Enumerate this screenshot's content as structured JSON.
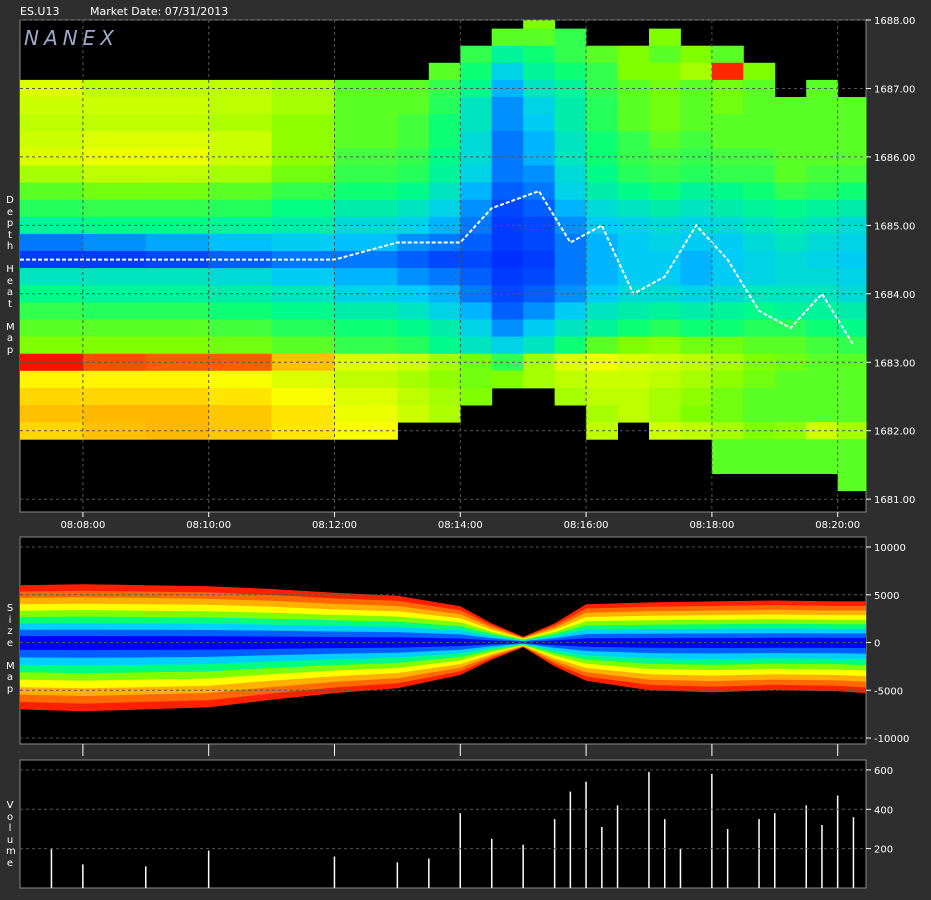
{
  "header": {
    "symbol": "ES.U13",
    "market_date": "Market Date: 07/31/2013"
  },
  "logo": "NANEX",
  "panel_labels": {
    "depth": "Depth Heat Map",
    "size": "Size Map",
    "volume": "Volume"
  },
  "colors": {
    "background": "#2e2e2e",
    "plot_bg": "#000000",
    "grid": "#555555",
    "text": "#ffffff",
    "logo": "#9fa9c9"
  },
  "chart_data": [
    {
      "type": "heatmap",
      "panel": "depth",
      "title": "Depth Heat Map",
      "x_ticks": [
        "08:08:00",
        "08:10:00",
        "08:12:00",
        "08:14:00",
        "08:16:00",
        "08:18:00",
        "08:20:00"
      ],
      "x_range": [
        "08:07:00",
        "08:20:27"
      ],
      "y_ticks": [
        "1688.00",
        "1687.00",
        "1686.00",
        "1685.00",
        "1684.00",
        "1683.00",
        "1682.00",
        "1681.00"
      ],
      "ylim": [
        1680.9,
        1688.0
      ],
      "grid": true,
      "colormap": [
        "#0000ff",
        "#00c8ff",
        "#00ff80",
        "#80ff00",
        "#ffff00",
        "#ff8000",
        "#ff0000"
      ],
      "columns_time": [
        "08:07:00",
        "08:08:00",
        "08:09:00",
        "08:10:00",
        "08:11:00",
        "08:12:00",
        "08:13:00",
        "08:13:30",
        "08:14:00",
        "08:14:30",
        "08:15:00",
        "08:15:30",
        "08:16:00",
        "08:16:30",
        "08:17:00",
        "08:17:30",
        "08:18:00",
        "08:18:30",
        "08:19:00",
        "08:19:30",
        "08:20:00"
      ],
      "price_levels": [
        1688.0,
        1687.75,
        1687.5,
        1687.25,
        1687.0,
        1686.75,
        1686.5,
        1686.25,
        1686.0,
        1685.75,
        1685.5,
        1685.25,
        1685.0,
        1684.75,
        1684.5,
        1684.25,
        1684.0,
        1683.75,
        1683.5,
        1683.25,
        1683.0,
        1682.75,
        1682.5,
        1682.25,
        1682.0,
        1681.75,
        1681.5,
        1681.25
      ],
      "intensity": [
        [
          null,
          null,
          null,
          null,
          null,
          null,
          null,
          null,
          null,
          null,
          0.5,
          null,
          null,
          null,
          null,
          null,
          null,
          null,
          null,
          null,
          null
        ],
        [
          null,
          null,
          null,
          null,
          null,
          null,
          null,
          null,
          null,
          0.45,
          0.45,
          0.4,
          null,
          null,
          0.5,
          null,
          null,
          null,
          null,
          null,
          null
        ],
        [
          null,
          null,
          null,
          null,
          null,
          null,
          null,
          null,
          0.4,
          0.3,
          0.35,
          0.4,
          0.45,
          0.5,
          0.45,
          0.5,
          0.45,
          null,
          null,
          null,
          null
        ],
        [
          null,
          null,
          null,
          null,
          null,
          null,
          null,
          0.45,
          0.35,
          0.2,
          0.3,
          0.35,
          0.4,
          0.5,
          0.5,
          0.55,
          0.95,
          0.5,
          null,
          null,
          null
        ],
        [
          0.62,
          0.58,
          0.58,
          0.58,
          0.55,
          0.45,
          0.45,
          0.4,
          0.32,
          0.15,
          0.25,
          0.3,
          0.4,
          0.45,
          0.48,
          0.45,
          0.48,
          0.45,
          null,
          0.45,
          null
        ],
        [
          0.6,
          0.6,
          0.6,
          0.58,
          0.55,
          0.45,
          0.45,
          0.38,
          0.25,
          0.12,
          0.2,
          0.28,
          0.38,
          0.45,
          0.48,
          0.45,
          0.48,
          0.45,
          0.45,
          0.45,
          0.45
        ],
        [
          0.58,
          0.58,
          0.58,
          0.56,
          0.52,
          0.45,
          0.42,
          0.35,
          0.25,
          0.12,
          0.18,
          0.28,
          0.38,
          0.45,
          0.48,
          0.45,
          0.45,
          0.45,
          0.45,
          0.45,
          0.45
        ],
        [
          0.6,
          0.62,
          0.62,
          0.6,
          0.52,
          0.45,
          0.42,
          0.35,
          0.22,
          0.1,
          0.15,
          0.25,
          0.35,
          0.4,
          0.45,
          0.42,
          0.45,
          0.45,
          0.45,
          0.45,
          0.45
        ],
        [
          0.62,
          0.64,
          0.64,
          0.6,
          0.52,
          0.42,
          0.4,
          0.32,
          0.22,
          0.1,
          0.15,
          0.25,
          0.35,
          0.4,
          0.42,
          0.4,
          0.42,
          0.42,
          0.45,
          0.45,
          0.45
        ],
        [
          0.55,
          0.58,
          0.58,
          0.55,
          0.48,
          0.4,
          0.38,
          0.3,
          0.2,
          0.1,
          0.12,
          0.22,
          0.32,
          0.38,
          0.4,
          0.38,
          0.4,
          0.4,
          0.45,
          0.42,
          0.42
        ],
        [
          0.45,
          0.48,
          0.48,
          0.45,
          0.4,
          0.35,
          0.32,
          0.25,
          0.15,
          0.08,
          0.1,
          0.2,
          0.28,
          0.32,
          0.35,
          0.3,
          0.32,
          0.35,
          0.4,
          0.38,
          0.35
        ],
        [
          0.38,
          0.4,
          0.4,
          0.38,
          0.33,
          0.28,
          0.25,
          0.2,
          0.12,
          0.06,
          0.08,
          0.15,
          0.22,
          0.25,
          0.28,
          0.25,
          0.28,
          0.3,
          0.32,
          0.3,
          0.28
        ],
        [
          0.3,
          0.32,
          0.32,
          0.3,
          0.28,
          0.22,
          0.2,
          0.15,
          0.1,
          0.05,
          0.06,
          0.12,
          0.18,
          0.2,
          0.22,
          0.2,
          0.22,
          0.25,
          0.28,
          0.25,
          0.22
        ],
        [
          0.1,
          0.12,
          0.14,
          0.16,
          0.18,
          0.16,
          0.12,
          0.1,
          0.08,
          0.05,
          0.06,
          0.1,
          0.15,
          0.18,
          0.2,
          0.18,
          0.18,
          0.22,
          0.25,
          0.22,
          0.2
        ],
        [
          0.05,
          0.05,
          0.06,
          0.08,
          0.1,
          0.1,
          0.08,
          0.06,
          0.06,
          0.04,
          0.05,
          0.1,
          0.15,
          0.18,
          0.18,
          0.15,
          0.18,
          0.2,
          0.22,
          0.2,
          0.18
        ],
        [
          0.25,
          0.25,
          0.25,
          0.22,
          0.18,
          0.15,
          0.12,
          0.1,
          0.08,
          0.05,
          0.06,
          0.1,
          0.15,
          0.18,
          0.18,
          0.15,
          0.18,
          0.2,
          0.22,
          0.22,
          0.2
        ],
        [
          0.32,
          0.3,
          0.3,
          0.28,
          0.25,
          0.2,
          0.18,
          0.15,
          0.1,
          0.06,
          0.08,
          0.12,
          0.18,
          0.22,
          0.22,
          0.2,
          0.22,
          0.25,
          0.25,
          0.25,
          0.22
        ],
        [
          0.4,
          0.38,
          0.38,
          0.35,
          0.32,
          0.28,
          0.25,
          0.2,
          0.15,
          0.08,
          0.12,
          0.18,
          0.25,
          0.28,
          0.3,
          0.28,
          0.3,
          0.32,
          0.3,
          0.3,
          0.28
        ],
        [
          0.45,
          0.45,
          0.45,
          0.42,
          0.38,
          0.35,
          0.32,
          0.28,
          0.2,
          0.12,
          0.18,
          0.25,
          0.3,
          0.35,
          0.38,
          0.35,
          0.35,
          0.38,
          0.38,
          0.35,
          0.32
        ],
        [
          0.5,
          0.5,
          0.5,
          0.48,
          0.45,
          0.4,
          0.38,
          0.32,
          0.25,
          0.2,
          0.25,
          0.35,
          0.45,
          0.5,
          0.52,
          0.48,
          0.48,
          0.45,
          0.45,
          0.42,
          0.4
        ],
        [
          0.98,
          0.9,
          0.88,
          0.88,
          0.75,
          0.62,
          0.6,
          0.55,
          0.48,
          0.4,
          0.55,
          0.62,
          0.65,
          0.62,
          0.6,
          0.58,
          0.55,
          0.5,
          0.48,
          0.45,
          0.45
        ],
        [
          0.68,
          0.68,
          0.68,
          0.66,
          0.62,
          0.58,
          0.55,
          0.52,
          0.48,
          0.5,
          0.55,
          0.58,
          0.6,
          0.6,
          0.58,
          0.55,
          0.52,
          0.48,
          0.45,
          0.45,
          0.45
        ],
        [
          0.72,
          0.72,
          0.72,
          0.7,
          0.66,
          0.62,
          0.58,
          0.55,
          0.5,
          null,
          null,
          0.55,
          0.58,
          0.58,
          0.55,
          0.52,
          0.48,
          0.45,
          0.45,
          0.45,
          0.45
        ],
        [
          0.75,
          0.76,
          0.76,
          0.74,
          0.7,
          0.64,
          0.6,
          0.56,
          null,
          null,
          null,
          null,
          0.55,
          0.58,
          0.55,
          0.5,
          0.48,
          0.45,
          0.45,
          0.45,
          0.45
        ],
        [
          0.72,
          0.75,
          0.76,
          0.74,
          0.7,
          0.66,
          null,
          null,
          null,
          null,
          null,
          null,
          0.58,
          null,
          0.6,
          0.58,
          0.55,
          0.5,
          0.52,
          0.6,
          0.55
        ],
        [
          null,
          null,
          null,
          null,
          null,
          null,
          null,
          null,
          null,
          null,
          null,
          null,
          null,
          null,
          null,
          null,
          0.45,
          0.45,
          0.45,
          0.45,
          0.45
        ],
        [
          null,
          null,
          null,
          null,
          null,
          null,
          null,
          null,
          null,
          null,
          null,
          null,
          null,
          null,
          null,
          null,
          0.45,
          0.45,
          0.45,
          0.45,
          0.45
        ],
        [
          null,
          null,
          null,
          null,
          null,
          null,
          null,
          null,
          null,
          null,
          null,
          null,
          null,
          null,
          null,
          null,
          null,
          null,
          null,
          null,
          0.45
        ]
      ],
      "trade_price_path": [
        {
          "t": "08:07:00",
          "p": 1684.5
        },
        {
          "t": "08:08:00",
          "p": 1684.5
        },
        {
          "t": "08:09:00",
          "p": 1684.5
        },
        {
          "t": "08:10:00",
          "p": 1684.5
        },
        {
          "t": "08:11:00",
          "p": 1684.5
        },
        {
          "t": "08:12:00",
          "p": 1684.5
        },
        {
          "t": "08:13:00",
          "p": 1684.75
        },
        {
          "t": "08:14:00",
          "p": 1684.75
        },
        {
          "t": "08:14:30",
          "p": 1685.25
        },
        {
          "t": "08:15:15",
          "p": 1685.5
        },
        {
          "t": "08:15:45",
          "p": 1684.75
        },
        {
          "t": "08:16:15",
          "p": 1685.0
        },
        {
          "t": "08:16:45",
          "p": 1684.0
        },
        {
          "t": "08:17:15",
          "p": 1684.25
        },
        {
          "t": "08:17:45",
          "p": 1685.0
        },
        {
          "t": "08:18:15",
          "p": 1684.5
        },
        {
          "t": "08:18:45",
          "p": 1683.75
        },
        {
          "t": "08:19:15",
          "p": 1683.5
        },
        {
          "t": "08:19:45",
          "p": 1684.0
        },
        {
          "t": "08:20:15",
          "p": 1683.25
        }
      ]
    },
    {
      "type": "area",
      "panel": "size",
      "title": "Size Map",
      "y_ticks": [
        "10000",
        "5000",
        "0",
        "-5000",
        "-10000"
      ],
      "ylim": [
        -10000,
        10000
      ],
      "grid": true,
      "colormap_outer_to_inner": [
        "#ff2000",
        "#ff6a00",
        "#ffb000",
        "#ffff00",
        "#80ff00",
        "#00ff80",
        "#00d0ff",
        "#0060ff",
        "#0000ff"
      ],
      "x": [
        "08:07:00",
        "08:08:00",
        "08:09:00",
        "08:10:00",
        "08:11:00",
        "08:12:00",
        "08:13:00",
        "08:14:00",
        "08:14:30",
        "08:15:00",
        "08:15:30",
        "08:16:00",
        "08:17:00",
        "08:18:00",
        "08:19:00",
        "08:20:00",
        "08:20:27"
      ],
      "upper_extent": [
        6000,
        6100,
        6000,
        5900,
        5600,
        5200,
        4900,
        3800,
        2000,
        600,
        2000,
        4000,
        4200,
        4300,
        4400,
        4300,
        4300
      ],
      "lower_extent": [
        -7000,
        -7200,
        -7000,
        -6800,
        -6000,
        -5300,
        -4800,
        -3400,
        -1800,
        -500,
        -2500,
        -4000,
        -5000,
        -5200,
        -5000,
        -5100,
        -5300
      ]
    },
    {
      "type": "bar",
      "panel": "volume",
      "title": "Volume",
      "y_ticks": [
        "600",
        "400",
        "200"
      ],
      "ylim": [
        0,
        620
      ],
      "grid": true,
      "color": "#ffffff",
      "x": [
        "08:07:30",
        "08:08:00",
        "08:09:00",
        "08:10:00",
        "08:12:00",
        "08:13:00",
        "08:13:30",
        "08:14:00",
        "08:14:30",
        "08:15:00",
        "08:15:30",
        "08:15:45",
        "08:16:00",
        "08:16:15",
        "08:16:30",
        "08:17:00",
        "08:17:15",
        "08:17:30",
        "08:18:00",
        "08:18:15",
        "08:18:45",
        "08:19:00",
        "08:19:30",
        "08:19:45",
        "08:20:00",
        "08:20:15"
      ],
      "values": [
        200,
        120,
        110,
        190,
        160,
        130,
        150,
        380,
        250,
        220,
        350,
        490,
        540,
        310,
        420,
        590,
        350,
        200,
        580,
        300,
        350,
        380,
        420,
        320,
        470,
        360
      ]
    }
  ]
}
